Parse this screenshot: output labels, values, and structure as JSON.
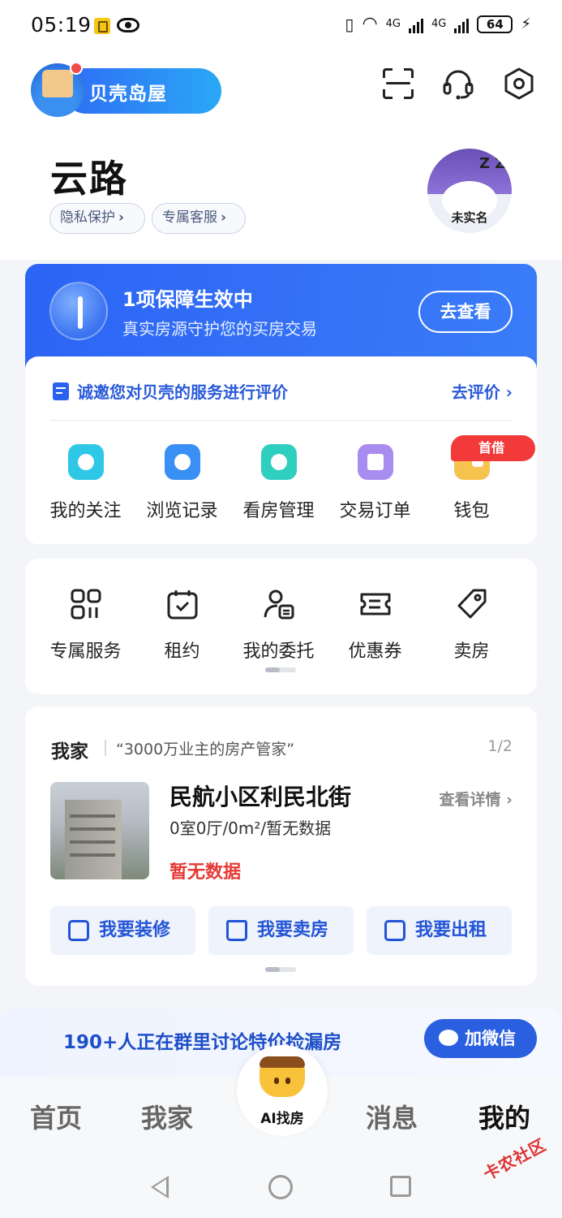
{
  "status_bar": {
    "time": "05:19",
    "battery": "64",
    "net1": "4G",
    "net2": "4G"
  },
  "header": {
    "logo_text": "贝壳岛屋"
  },
  "profile": {
    "name": "云路",
    "chip_privacy": "隐私保护",
    "chip_service": "专属客服",
    "avatar_label": "未实名",
    "avatar_zz": "Z Z"
  },
  "protection": {
    "title": "1项保障生效中",
    "subtitle": "真实房源守护您的买房交易",
    "button": "去查看"
  },
  "evaluation": {
    "text": "诚邀您对贝壳的服务进行评价",
    "link": "去评价"
  },
  "quick_actions": [
    {
      "label": "我的关注",
      "icon": "heart-icon",
      "color": "#2ec7e6"
    },
    {
      "label": "浏览记录",
      "icon": "browse-icon",
      "color": "#3a8ff5"
    },
    {
      "label": "看房管理",
      "icon": "folder-icon",
      "color": "#2fcfc0"
    },
    {
      "label": "交易订单",
      "icon": "clipboard-icon",
      "color": "#a98cf0"
    },
    {
      "label": "钱包",
      "icon": "wallet-icon",
      "color": "#f6c34e"
    }
  ],
  "wallet_badge": "首借",
  "services": [
    {
      "label": "专属服务",
      "icon": "apps-grid-icon"
    },
    {
      "label": "租约",
      "icon": "calendar-check-icon"
    },
    {
      "label": "我的委托",
      "icon": "user-doc-icon"
    },
    {
      "label": "优惠券",
      "icon": "coupon-icon"
    },
    {
      "label": "卖房",
      "icon": "tag-icon"
    }
  ],
  "home": {
    "title": "我家",
    "slogan": "“3000万业主的房产管家”",
    "page": "1/2",
    "house_name": "民航小区利民北街",
    "detail_link": "查看详情",
    "spec": "0室0厅/0m²/暂无数据",
    "no_data": "暂无数据",
    "btn_renovate": "我要装修",
    "btn_sell": "我要卖房",
    "btn_rent": "我要出租"
  },
  "group": {
    "text": "190+人正在群里讨论特价捡漏房",
    "button": "加微信"
  },
  "tabs": {
    "home": "首页",
    "myhome": "我家",
    "ai": "AI找房",
    "messages": "消息",
    "mine": "我的"
  },
  "watermark": "卡农社区",
  "colors": {
    "brand_blue": "#2c64f5",
    "accent_red": "#e53935"
  }
}
